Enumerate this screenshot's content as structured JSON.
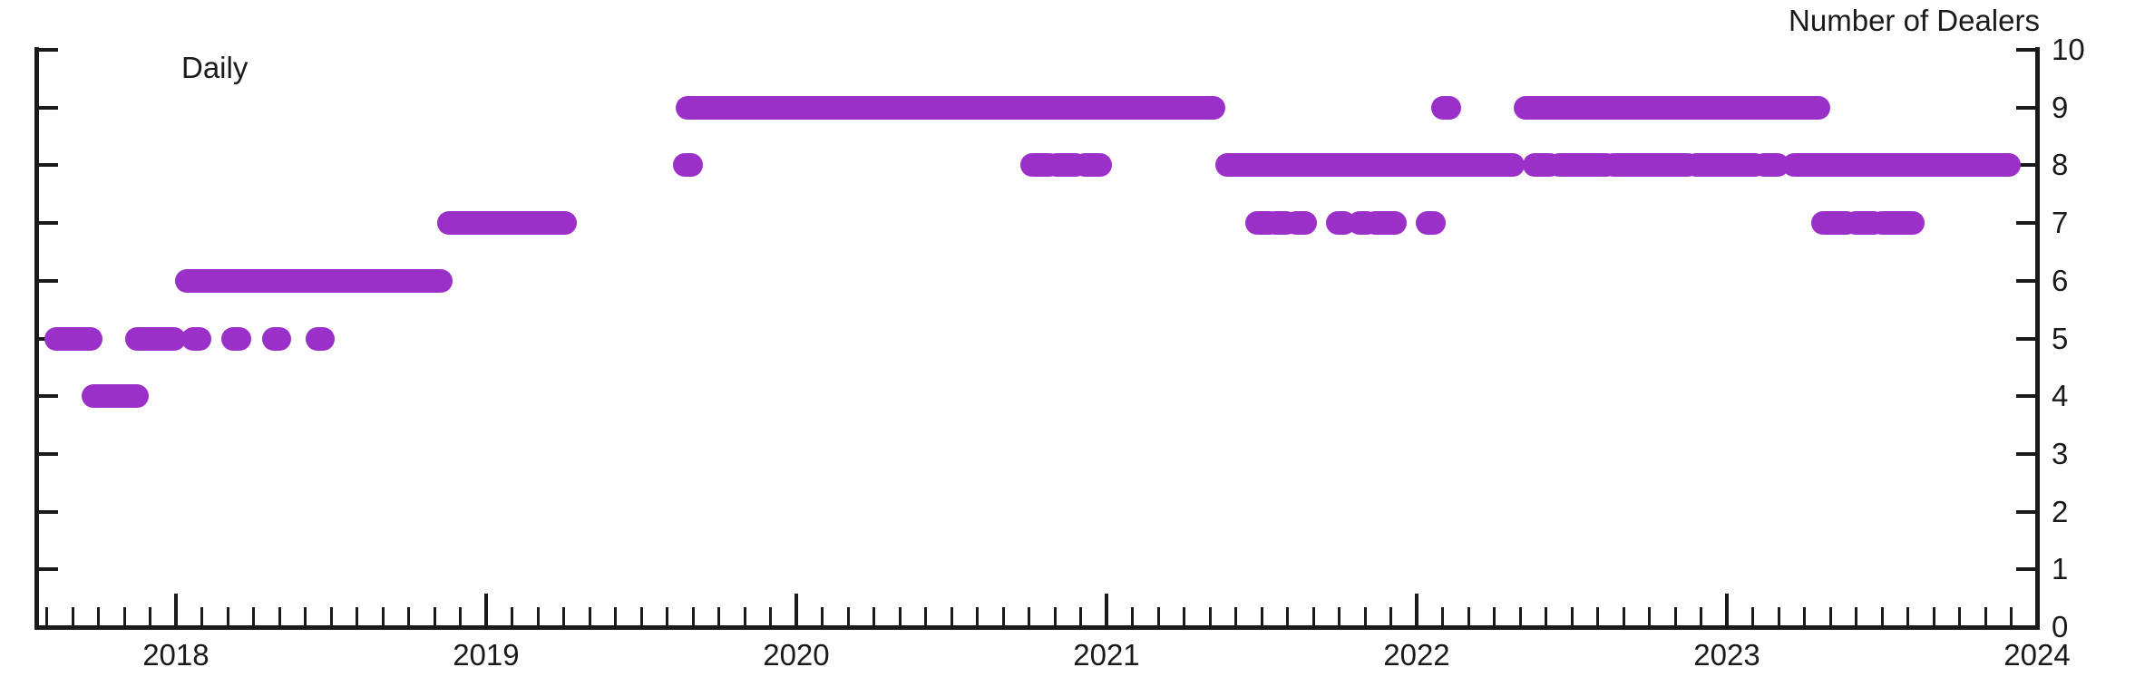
{
  "axis_title": "Number of Dealers",
  "frequency_note": "Daily",
  "accent_color": "#9B30C8",
  "axis_color": "#1a1a1a",
  "background_color": "#ffffff",
  "y_labels": [
    "10",
    "9",
    "8",
    "7",
    "6",
    "5",
    "4",
    "3",
    "2",
    "1",
    "0"
  ],
  "x_labels": [
    "2018",
    "2019",
    "2020",
    "2021",
    "2022",
    "2023",
    "2024"
  ],
  "chart_data": {
    "type": "scatter",
    "title": "",
    "subtitle": "",
    "annotation": "Daily",
    "xlabel": "",
    "ylabel": "Number of Dealers",
    "ylabel_position": "right",
    "xlim": [
      2017.55,
      2024.0
    ],
    "ylim": [
      0,
      10
    ],
    "yticks": [
      0,
      1,
      2,
      3,
      4,
      5,
      6,
      7,
      8,
      9,
      10
    ],
    "xticks": [
      2018,
      2019,
      2020,
      2021,
      2022,
      2023,
      2024
    ],
    "x_minor_tick_interval_months": 1,
    "grid": false,
    "legend": null,
    "marker": "filled-circle",
    "marker_color": "#9B30C8",
    "series": [
      {
        "name": "Number of Dealers",
        "color": "#9B30C8",
        "segments": [
          {
            "y": 5,
            "x_start": 2017.615,
            "x_end": 2017.725
          },
          {
            "y": 4,
            "x_start": 2017.735,
            "x_end": 2017.875
          },
          {
            "y": 5,
            "x_start": 2017.875,
            "x_end": 2017.995
          },
          {
            "y": 5,
            "x_start": 2018.055,
            "x_end": 2018.075
          },
          {
            "y": 6,
            "x_start": 2018.035,
            "x_end": 2018.855
          },
          {
            "y": 5,
            "x_start": 2018.185,
            "x_end": 2018.205
          },
          {
            "y": 5,
            "x_start": 2018.315,
            "x_end": 2018.335
          },
          {
            "y": 5,
            "x_start": 2018.455,
            "x_end": 2018.475
          },
          {
            "y": 7,
            "x_start": 2018.88,
            "x_end": 2019.255
          },
          {
            "y": 9,
            "x_start": 2019.65,
            "x_end": 2021.345
          },
          {
            "y": 8,
            "x_start": 2019.64,
            "x_end": 2019.66
          },
          {
            "y": 8,
            "x_start": 2020.76,
            "x_end": 2020.815
          },
          {
            "y": 8,
            "x_start": 2020.84,
            "x_end": 2020.9
          },
          {
            "y": 8,
            "x_start": 2020.93,
            "x_end": 2020.98
          },
          {
            "y": 8,
            "x_start": 2021.39,
            "x_end": 2022.31
          },
          {
            "y": 7,
            "x_start": 2021.485,
            "x_end": 2021.525
          },
          {
            "y": 7,
            "x_start": 2021.545,
            "x_end": 2021.58
          },
          {
            "y": 7,
            "x_start": 2021.61,
            "x_end": 2021.64
          },
          {
            "y": 7,
            "x_start": 2021.745,
            "x_end": 2021.765
          },
          {
            "y": 7,
            "x_start": 2021.815,
            "x_end": 2021.84
          },
          {
            "y": 7,
            "x_start": 2021.865,
            "x_end": 2021.93
          },
          {
            "y": 7,
            "x_start": 2022.035,
            "x_end": 2022.055
          },
          {
            "y": 9,
            "x_start": 2022.085,
            "x_end": 2022.105
          },
          {
            "y": 9,
            "x_start": 2022.35,
            "x_end": 2023.295
          },
          {
            "y": 8,
            "x_start": 2022.38,
            "x_end": 2022.43
          },
          {
            "y": 8,
            "x_start": 2022.46,
            "x_end": 2022.61
          },
          {
            "y": 8,
            "x_start": 2022.635,
            "x_end": 2022.875
          },
          {
            "y": 8,
            "x_start": 2022.9,
            "x_end": 2023.09
          },
          {
            "y": 8,
            "x_start": 2023.12,
            "x_end": 2023.165
          },
          {
            "y": 8,
            "x_start": 2023.215,
            "x_end": 2023.91
          },
          {
            "y": 7,
            "x_start": 2023.31,
            "x_end": 2023.385
          },
          {
            "y": 7,
            "x_start": 2023.415,
            "x_end": 2023.475
          },
          {
            "y": 7,
            "x_start": 2023.5,
            "x_end": 2023.6
          }
        ]
      }
    ]
  }
}
